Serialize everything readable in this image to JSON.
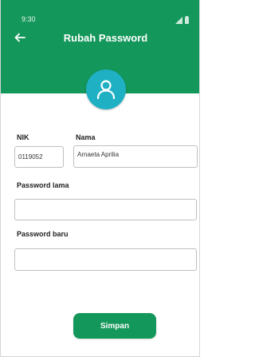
{
  "status_bar": {
    "time": "9:30"
  },
  "header": {
    "title": "Rubah Password",
    "back_icon": "arrow-left-icon"
  },
  "avatar": {
    "icon": "user-icon"
  },
  "form": {
    "nik_label": "NIK",
    "nik_value": "0119052",
    "nama_label": "Nama",
    "nama_value": "Arnaeta Aprilia",
    "old_password_label": "Password lama",
    "old_password_value": "",
    "new_password_label": "Password baru",
    "new_password_value": ""
  },
  "actions": {
    "save_label": "Simpan"
  },
  "colors": {
    "primary": "#14975a",
    "avatar": "#1fb0c4"
  }
}
